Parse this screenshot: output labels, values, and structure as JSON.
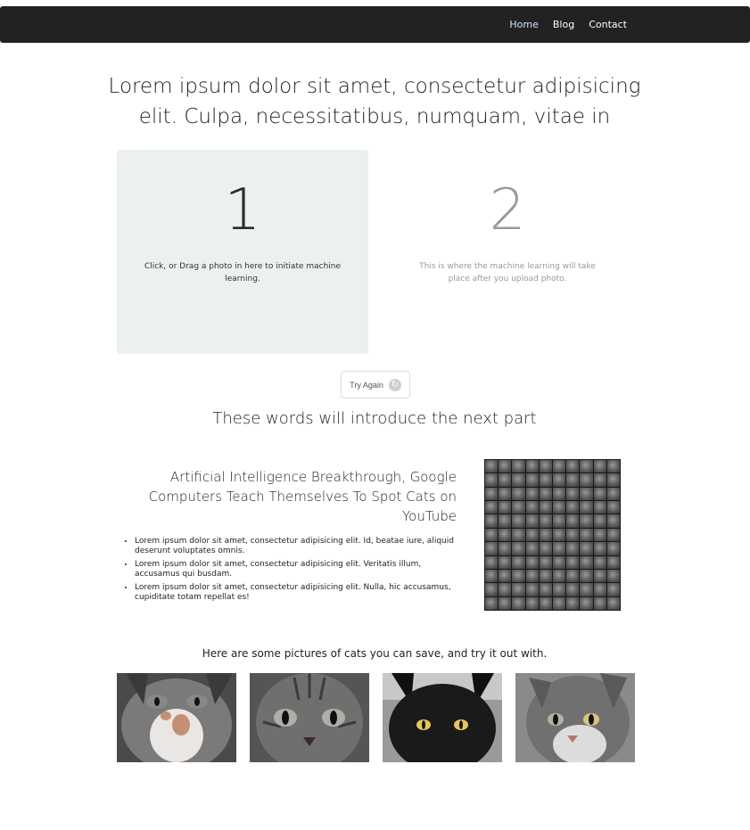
{
  "nav": {
    "items": [
      "Home",
      "Blog",
      "Contact"
    ],
    "active": "Home"
  },
  "hero": {
    "title": "Lorem ipsum dolor sit amet, consectetur adipisicing elit. Culpa, necessitatibus, numquam, vitae in"
  },
  "steps": [
    {
      "number": "1",
      "text": "Click, or Drag a photo in here to initiate machine learning."
    },
    {
      "number": "2",
      "text": "This is where the machine learning will take place after you upload photo."
    }
  ],
  "try_again": {
    "label": "Try Again",
    "icon": "refresh-icon"
  },
  "intro": {
    "heading": "These words will introduce the next part"
  },
  "article": {
    "title": "Artificial Intelligence Breakthrough, Google Computers Teach Themselves To Spot Cats on YouTube",
    "bullets": [
      "Lorem ipsum dolor sit amet, consectetur adipisicing elit. Id, beatae iure, aliquid deserunt voluptates omnis.",
      "Lorem ipsum dolor sit amet, consectetur adipisicing elit. Veritatis illum, accusamus qui busdam.",
      "Lorem ipsum dolor sit amet, consectetur adipisicing elit. Nulla, hic accusamus, cupiditate totam repellat es!"
    ]
  },
  "cats_section": {
    "heading": "Here are some pictures of cats you can save, and try it out with."
  },
  "colors": {
    "navbar": "#222222",
    "panel_bg": "#ecf0f1"
  }
}
